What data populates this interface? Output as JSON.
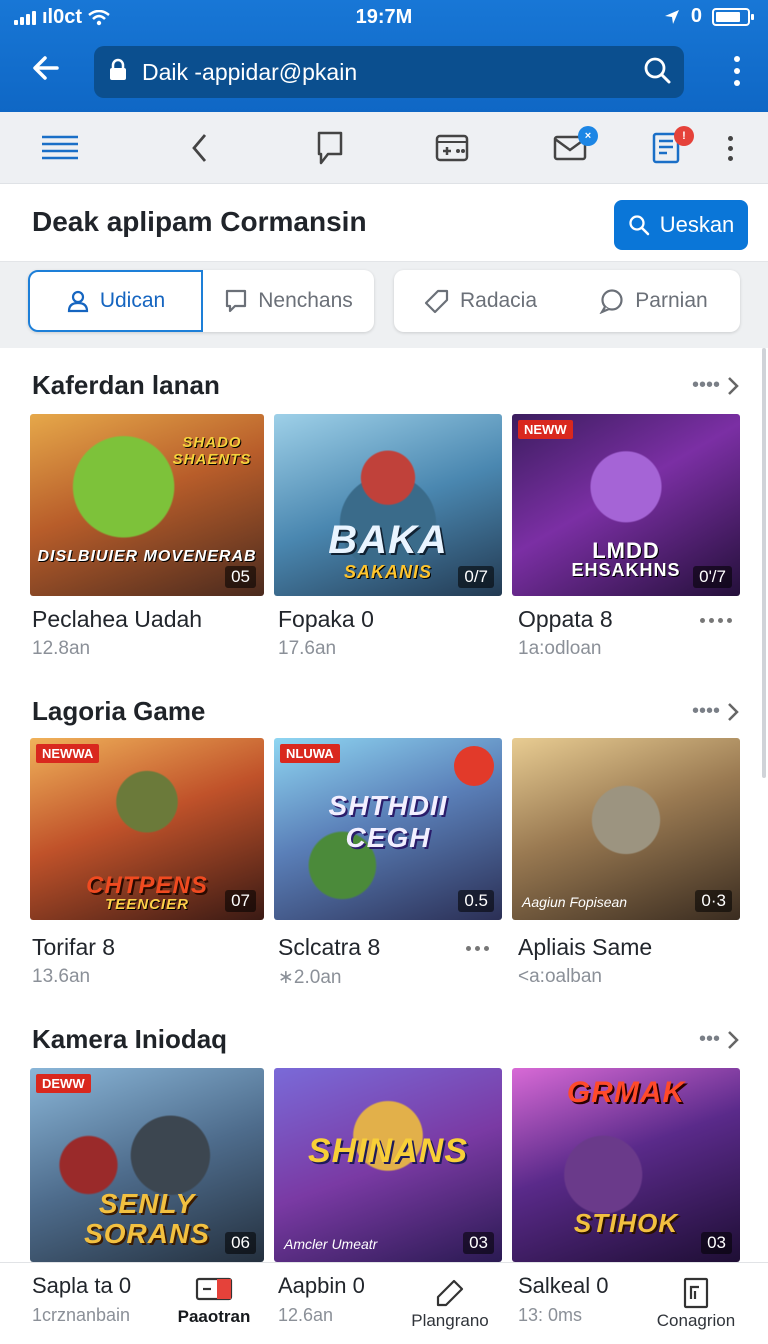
{
  "status_bar": {
    "carrier": "ıl0ct",
    "time": "19:7M",
    "right": "0"
  },
  "url_bar": {
    "url": "Daik -appidar@pkain"
  },
  "header": {
    "title": "Deak  aplipam Cormansin",
    "button_label": "Ueskan"
  },
  "tabs": [
    {
      "label": "Udican",
      "icon": "user-icon",
      "active": true
    },
    {
      "label": "Nenchans",
      "icon": "comment-icon"
    },
    {
      "label": "Radacia",
      "icon": "tag-icon"
    },
    {
      "label": "Parnian",
      "icon": "chat-icon"
    }
  ],
  "sections": [
    {
      "title": "Kaferdan lanan",
      "cards": [
        {
          "title": "Peclahea Uadah",
          "meta": "12.8an",
          "duration": "05",
          "flag": "",
          "logo": "SHADO SHAENTS",
          "logo2": "DISLBIUIER MOVENERAB"
        },
        {
          "title": "Fopaka 0",
          "meta": "17.6an",
          "duration": "0/7",
          "flag": "",
          "logo": "BAKA",
          "logo2": "SAKANIS"
        },
        {
          "title": "Oppata 8",
          "meta": "1a:odloan",
          "duration": "0'/7",
          "flag": "NEWW",
          "logo": "LMDD",
          "logo2": "EHSAKHNS"
        }
      ]
    },
    {
      "title": "Lagoria Game",
      "cards": [
        {
          "title": "Torifar 8",
          "meta": "13.6an",
          "duration": "07",
          "flag": "NEWWA",
          "logo": "CHTPENS",
          "logo2": "TEENCIER"
        },
        {
          "title": "Sclcatra 8",
          "meta": "∗2.0an",
          "duration": "0.5",
          "flag": "NLUWA",
          "logo": "SHTHDII",
          "logo2": "CEGH"
        },
        {
          "title": "Apliais Same",
          "meta": "<a:oalban",
          "duration": "0·3",
          "flag": "",
          "logo": "",
          "logo2": "",
          "caption": "Aagiun Fopisean"
        }
      ]
    },
    {
      "title": "Kamera Iniodaq",
      "cards": [
        {
          "title": "Sapla ta 0",
          "meta": "1crznanbain",
          "duration": "06",
          "flag": "DEWW",
          "logo": "SENLY",
          "logo2": "SORANS"
        },
        {
          "title": "Aapbin 0",
          "meta": "12.6an",
          "duration": "03",
          "flag": "",
          "logo": "SHINANS",
          "logo2": "",
          "caption": "Amcler Umeatr"
        },
        {
          "title": "Salkeal 0",
          "meta": "13: 0ms",
          "duration": "03",
          "flag": "",
          "logo": "GRMAK",
          "logo2": "STIHOK"
        }
      ]
    }
  ],
  "bottom_nav": [
    {
      "label": "Paaotran",
      "icon": "video-icon",
      "active": true
    },
    {
      "label": "Plangrano",
      "icon": "pen-icon"
    },
    {
      "label": "Conagrion",
      "icon": "document-icon"
    }
  ]
}
